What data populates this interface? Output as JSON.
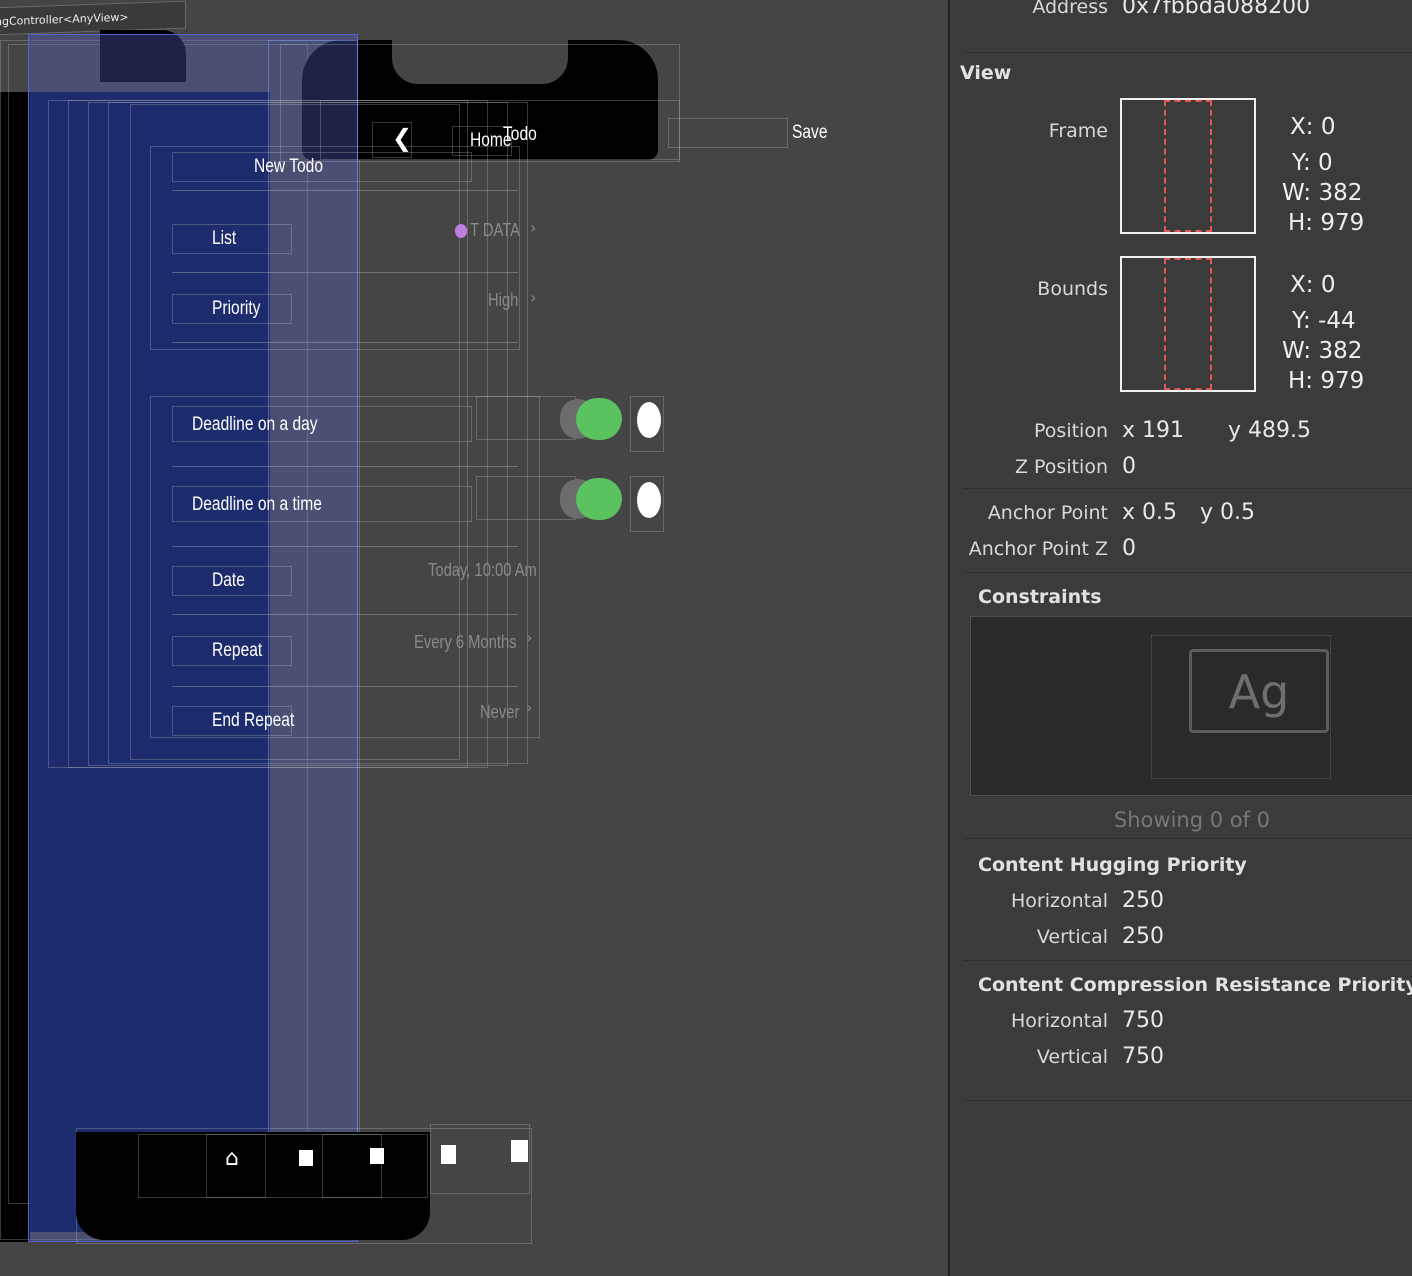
{
  "canvas": {
    "controller_title": "ngController<AnyView>",
    "nav": {
      "back_glyph": "❮",
      "home_label": "Home",
      "title": "Todo",
      "save_label": "Save"
    },
    "form_title": "New Todo",
    "rows": {
      "list": {
        "label": "List",
        "value": "T DATA",
        "dot_color": "#c07de0"
      },
      "priority": {
        "label": "Priority",
        "value": "High"
      },
      "deadline_day": {
        "label": "Deadline on a day",
        "state": "on"
      },
      "deadline_time": {
        "label": "Deadline on a time",
        "state": "on"
      },
      "date": {
        "label": "Date",
        "value": "Today, 10:00 Am"
      },
      "repeat": {
        "label": "Repeat",
        "value": "Every 6 Months"
      },
      "end_repeat": {
        "label": "End Repeat",
        "value": "Never"
      }
    },
    "chevron": "›",
    "tabbar": {
      "icons": [
        "house-icon",
        "square-icon",
        "square-icon",
        "square-icon",
        "square-icon"
      ]
    },
    "colors": {
      "toggle_on": "#5ac35f",
      "blue_slab": "#5560d0",
      "dark_slab": "#00103b"
    }
  },
  "inspector": {
    "address_label": "Address",
    "address_value": "0x7fbbda088200",
    "view_heading": "View",
    "frame": {
      "label": "Frame",
      "x": "X:  0",
      "y": "Y:  0",
      "w": "W:  382",
      "h": "H:  979"
    },
    "bounds": {
      "label": "Bounds",
      "x": "X:  0",
      "y": "Y:  -44",
      "w": "W:  382",
      "h": "H:  979"
    },
    "position": {
      "label": "Position",
      "x": "x  191",
      "y": "y  489.5"
    },
    "z_position": {
      "label": "Z Position",
      "value": "0"
    },
    "anchor_point": {
      "label": "Anchor Point",
      "x": "x  0.5",
      "y": "y  0.5"
    },
    "anchor_point_z": {
      "label": "Anchor Point Z",
      "value": "0"
    },
    "constraints": {
      "heading": "Constraints",
      "glyph": "Ag",
      "showing": "Showing 0 of 0"
    },
    "hugging": {
      "heading": "Content Hugging Priority",
      "h_label": "Horizontal",
      "h_value": "250",
      "v_label": "Vertical",
      "v_value": "250"
    },
    "compression": {
      "heading": "Content Compression Resistance Priority",
      "h_label": "Horizontal",
      "h_value": "750",
      "v_label": "Vertical",
      "v_value": "750"
    }
  }
}
